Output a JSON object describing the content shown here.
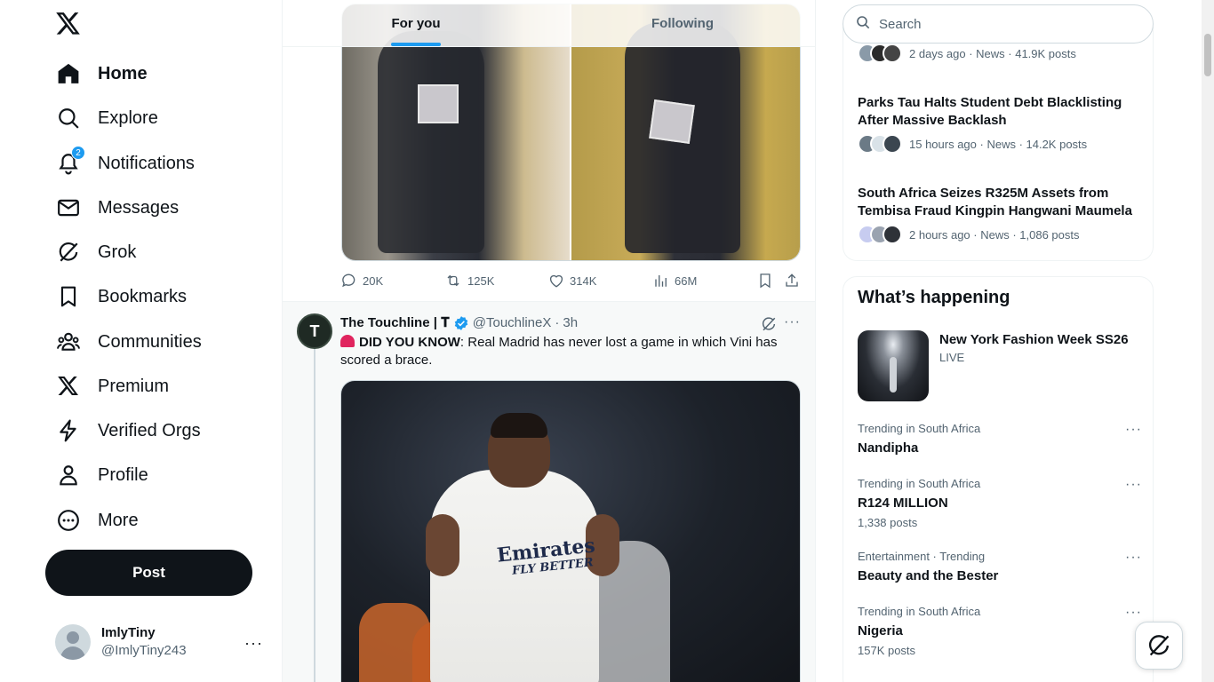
{
  "nav": {
    "items": [
      {
        "label": "Home",
        "icon": "home-icon"
      },
      {
        "label": "Explore",
        "icon": "search-icon"
      },
      {
        "label": "Notifications",
        "icon": "bell-icon",
        "badge": "2"
      },
      {
        "label": "Messages",
        "icon": "envelope-icon"
      },
      {
        "label": "Grok",
        "icon": "grok-icon"
      },
      {
        "label": "Bookmarks",
        "icon": "bookmark-icon"
      },
      {
        "label": "Communities",
        "icon": "communities-icon"
      },
      {
        "label": "Premium",
        "icon": "x-logo-icon"
      },
      {
        "label": "Verified Orgs",
        "icon": "lightning-icon"
      },
      {
        "label": "Profile",
        "icon": "person-icon"
      },
      {
        "label": "More",
        "icon": "more-circle-icon"
      }
    ],
    "post_label": "Post"
  },
  "account": {
    "name": "ImlyTiny",
    "handle": "@ImlyTiny243",
    "more": "···"
  },
  "tabs": [
    {
      "label": "For you",
      "active": true
    },
    {
      "label": "Following",
      "active": false
    }
  ],
  "prev_tweet_actions": {
    "replies": "20K",
    "reposts": "125K",
    "likes": "314K",
    "views": "66M"
  },
  "tweet": {
    "avatar_letter": "T",
    "name": "The Touchline | 𝐓",
    "handle": "@TouchlineX",
    "dot": "·",
    "time": "3h",
    "more": "···",
    "text_bold": "DID YOU KNOW",
    "text_rest": ": Real Madrid has never lost a game in which Vini has scored a brace.",
    "media_sponsor": "Emirates",
    "media_sponsor2": "FLY BETTER"
  },
  "search": {
    "placeholder": "Search"
  },
  "news": [
    {
      "title": "",
      "meta": "2 days ago · News · 41.9K posts"
    },
    {
      "title": "Parks Tau Halts Student Debt Blacklisting After Massive Backlash",
      "meta": "15 hours ago · News · 14.2K posts"
    },
    {
      "title": "South Africa Seizes R325M Assets from Tembisa Fraud Kingpin Hangwani Maumela",
      "meta": "2 hours ago · News · 1,086 posts"
    }
  ],
  "happening": {
    "title": "What’s happening",
    "event": {
      "title": "New York Fashion Week SS26",
      "status": "LIVE"
    },
    "trends": [
      {
        "category": "Trending in South Africa",
        "name": "Nandipha",
        "posts": ""
      },
      {
        "category": "Trending in South Africa",
        "name": "R124 MILLION",
        "posts": "1,338 posts"
      },
      {
        "category": "Entertainment · Trending",
        "name": "Beauty and the Bester",
        "posts": ""
      },
      {
        "category": "Trending in South Africa",
        "name": "Nigeria",
        "posts": "157K posts"
      }
    ],
    "more": "···"
  },
  "colors": {
    "accent": "#1d9bf0",
    "text": "#0f1419",
    "muted": "#536471",
    "border": "#eff3f4"
  }
}
